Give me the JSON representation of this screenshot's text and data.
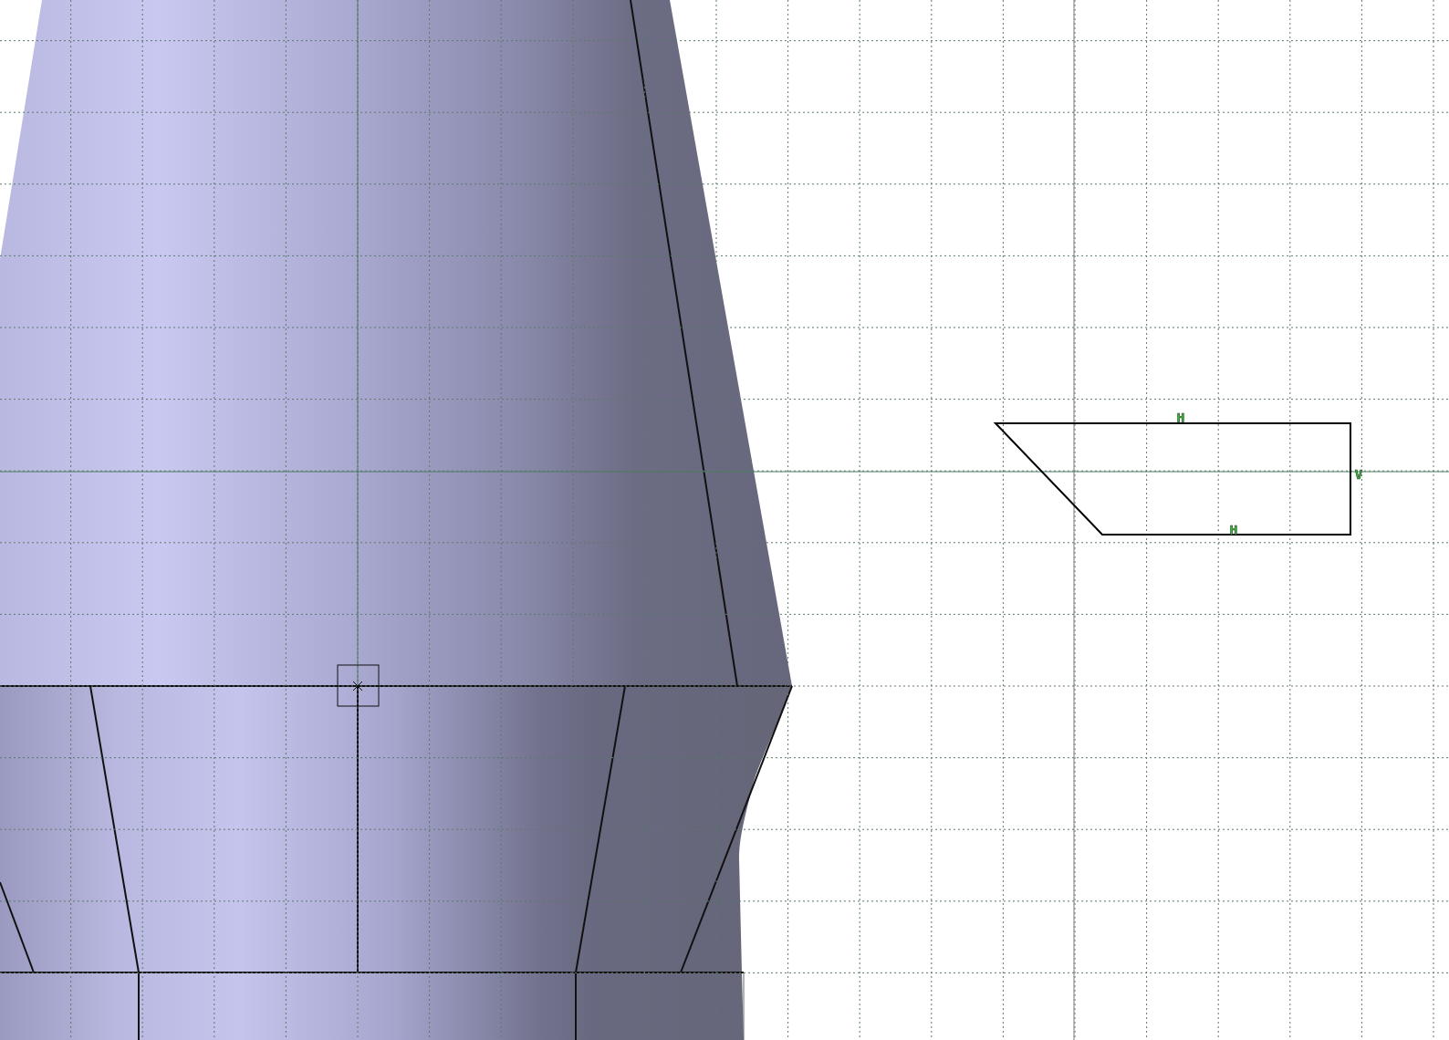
{
  "sketch": {
    "constraints": [
      {
        "kind": "horizontal",
        "label": "H"
      },
      {
        "kind": "horizontal",
        "label": "H"
      },
      {
        "kind": "vertical",
        "label": "V"
      }
    ]
  }
}
